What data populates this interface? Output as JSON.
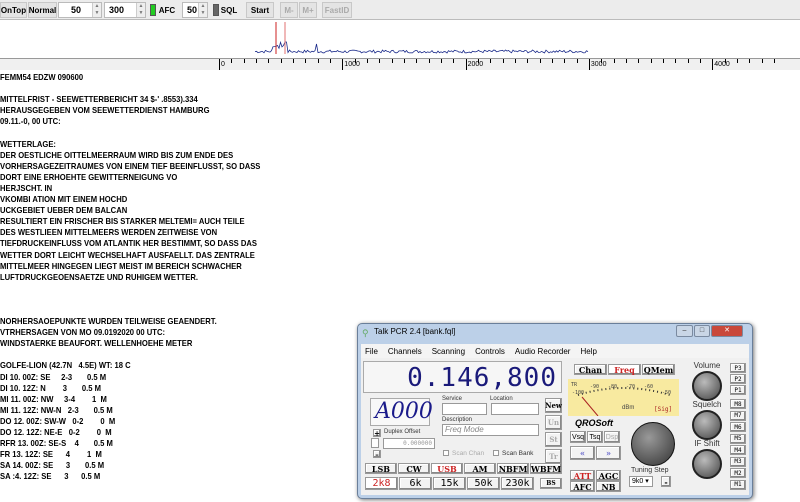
{
  "toolbar": {
    "ontop": "OnTop",
    "normal": "Normal",
    "spin1": "50",
    "spin2": "300",
    "afc": "AFC",
    "spin3": "50",
    "sql": "SQL",
    "start": "Start",
    "mminus": "M-",
    "mplus": "M+",
    "fastid": "FastID",
    "afc_color": "#22cc22",
    "sql_color": "#666666"
  },
  "scale": {
    "ticks": [
      "0",
      "1000",
      "2000",
      "3000",
      "4000"
    ]
  },
  "spectrum": {
    "trace_color": "#1a2a8a",
    "marker_color": "#cc2222",
    "range_hz": [
      0,
      4000
    ]
  },
  "text_lines": [
    "FEMM54 EDZW 090600",
    "",
    "MITTELFRIST - SEEWETTERBERICHT 34 $-' .8553).334",
    "HERAUSGEGEBEN VOM SEEWETTERDIENST HAMBURG",
    "09.11.-0, 00 UTC:",
    "",
    "WETTERLAGE:",
    "DER OESTLICHE OITTELMEERRAUM WIRD BIS ZUM ENDE DES",
    "VORHERSAGEZEITRAUMES VON EINEM TIEF BEEINFLUSST, SO DASS",
    "DORT EINE ERHOEHTE GEWITTERNEIGUNG VO",
    "HERJSCHT. IN",
    "VKOMBI ATION MIT EINEM HOCHD",
    "UCKGEBIET UEBER DEM BALCAN",
    "RESULTIERT EIN FRISCHER BIS STARKER MELTEMI= AUCH TEILE",
    "DES WESTLIEEN MITTELMEERS WERDEN ZEITWEISE VON",
    "TIEFDRUCKEINFLUSS VOM ATLANTIK HER BESTIMMT, SO DASS DAS",
    "WETTER DORT LEICHT WECHSELHAFT AUSFAELLT. DAS ZENTRALE",
    "MITTELMEER HINGEGEN LIEGT MEIST IM BEREICH SCHWACHER",
    "LUFTDRUCKGEOENSAETZE UND RUHIGEM WETTER.",
    "",
    "",
    "",
    "NORHERSAOEPUNKTE WURDEN TEILWEISE GEAENDERT.",
    "VTRHERSAGEN VON MO 09.0192020 00 UTC:",
    "WINDSTAERKE BEAUFORT. WELLENHOEHE METER",
    "",
    "GOLFE-LION (42.7N   4.5E) WT: 18 C",
    "DI 10. 00Z: SE     2-3       0.5 M",
    "DI 10. 12Z: N        3       0.5 M",
    "MI 11. 00Z: NW     3-4        1  M",
    "MI 11. 12Z: NW-N   2-3       0.5 M",
    "DO 12. 00Z: SW-W   0-2        0  M",
    "DO 12. 12Z: NE-E   0-2        0  M",
    "RFR 13. 00Z: SE-S    4       0.5 M",
    "FR 13. 12Z: SE      4        1  M",
    "SA 14. 00Z: SE      3       0.5 M",
    "SA :4. 12Z: SE      3      0.5 M"
  ],
  "window": {
    "title": "Talk PCR 2.4 [bank.fql]",
    "menu": [
      "File",
      "Channels",
      "Scanning",
      "Controls",
      "Audio Recorder",
      "Help"
    ],
    "frequency": "0.146,800",
    "channel": "A000",
    "service_label": "Service",
    "location_label": "Location",
    "description_label": "Description",
    "description_placeholder": "Freq Mode",
    "duplex_label": "Duplex Offset",
    "duplex_value": "0.000000",
    "scan_chan": "Scan Chan",
    "scan_bank": "Scan Bank",
    "side_buttons": [
      "New",
      "Un",
      "St",
      "Tr"
    ],
    "modes": [
      "LSB",
      "CW",
      "USB",
      "AM",
      "NBFM",
      "WBFM"
    ],
    "active_mode": "USB",
    "filters": [
      "2k8",
      "6k",
      "15k",
      "50k",
      "230k"
    ],
    "active_filter": "2k8",
    "bs": "BS",
    "view_tabs": [
      "Chan",
      "Freq",
      "QMem"
    ],
    "active_tab": "Freq",
    "meter": {
      "labels": [
        "-100",
        "-90",
        "-80",
        "-70",
        "-60",
        "-50"
      ],
      "tr": "TR",
      "unit": "dBm",
      "sig": "[Sig]",
      "bg": "#f8eaa0"
    },
    "brand": "QROSoft",
    "vsq": [
      "Vsq",
      "Tsq",
      "Dsp"
    ],
    "att": "ATT",
    "agc": "AGC",
    "afc": "AFC",
    "nb": "NB",
    "tuning_step_label": "Tuning Step",
    "tuning_step": "9k0",
    "knobs": [
      "Volume",
      "Squelch",
      "IF Shift"
    ],
    "p_buttons": [
      "P3",
      "P2",
      "P1"
    ],
    "m_buttons": [
      "M8",
      "M7",
      "M6",
      "M5",
      "M4",
      "M3",
      "M2",
      "M1"
    ]
  }
}
